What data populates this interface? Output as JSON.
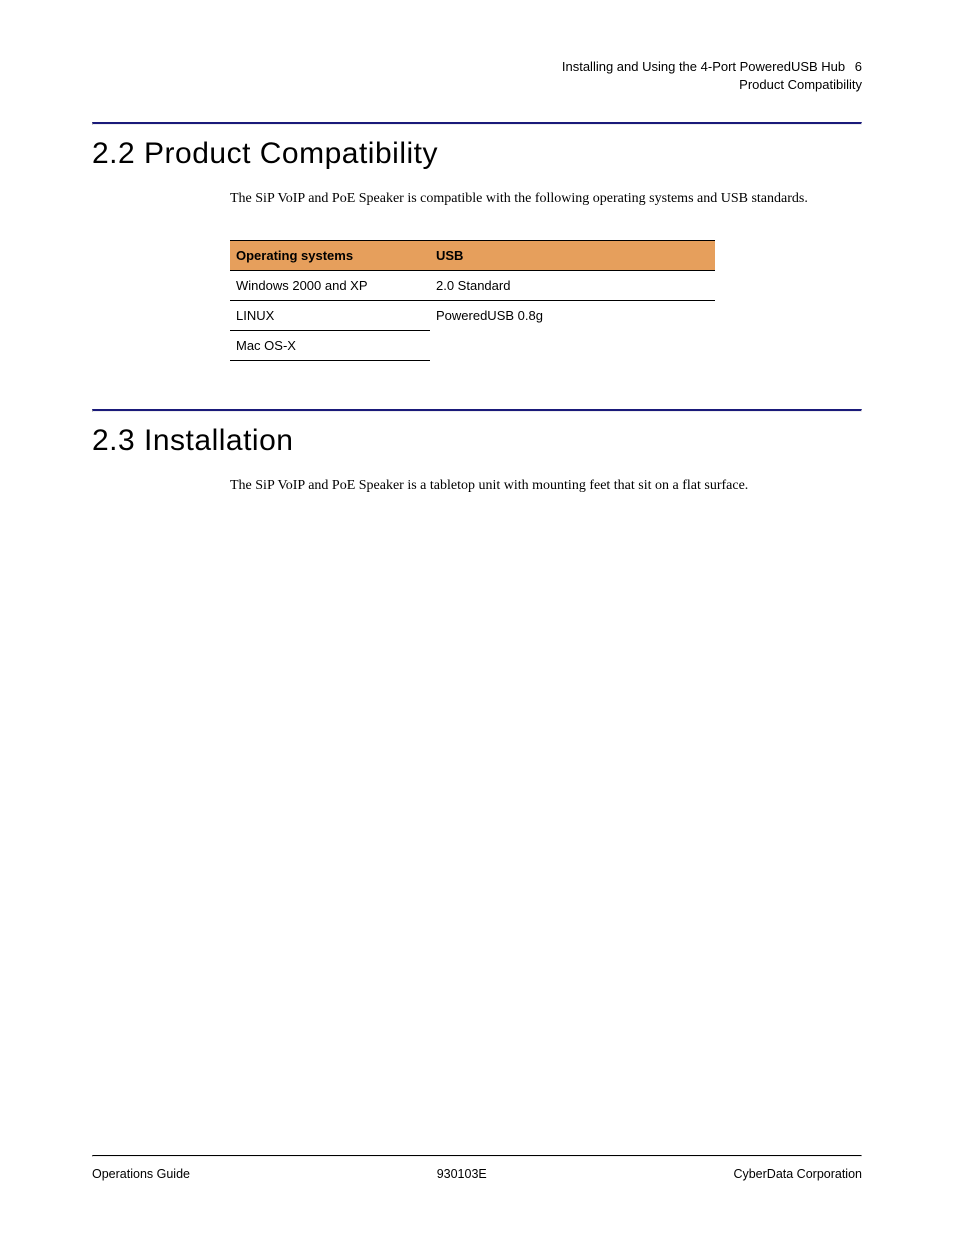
{
  "header": {
    "line1": "Installing and Using the 4-Port PoweredUSB Hub",
    "page_num": "6",
    "line2": "Product Compatibility"
  },
  "section_22": {
    "heading": "2.2 Product Compatibility",
    "intro": "The SiP VoIP and PoE Speaker is compatible with the following operating systems and USB standards.",
    "table": {
      "headers": [
        "Operating systems",
        "USB"
      ],
      "rows": [
        [
          "Windows 2000 and XP",
          "2.0 Standard"
        ],
        [
          "LINUX",
          "PoweredUSB 0.8g"
        ],
        [
          "Mac OS-X",
          ""
        ]
      ]
    }
  },
  "section_23": {
    "heading": "2.3 Installation",
    "intro": "The SiP VoIP and PoE Speaker is a tabletop unit with mounting feet that sit on a flat surface."
  },
  "footer": {
    "left": "Operations Guide",
    "center": "930103E",
    "right": "CyberData Corporation"
  }
}
